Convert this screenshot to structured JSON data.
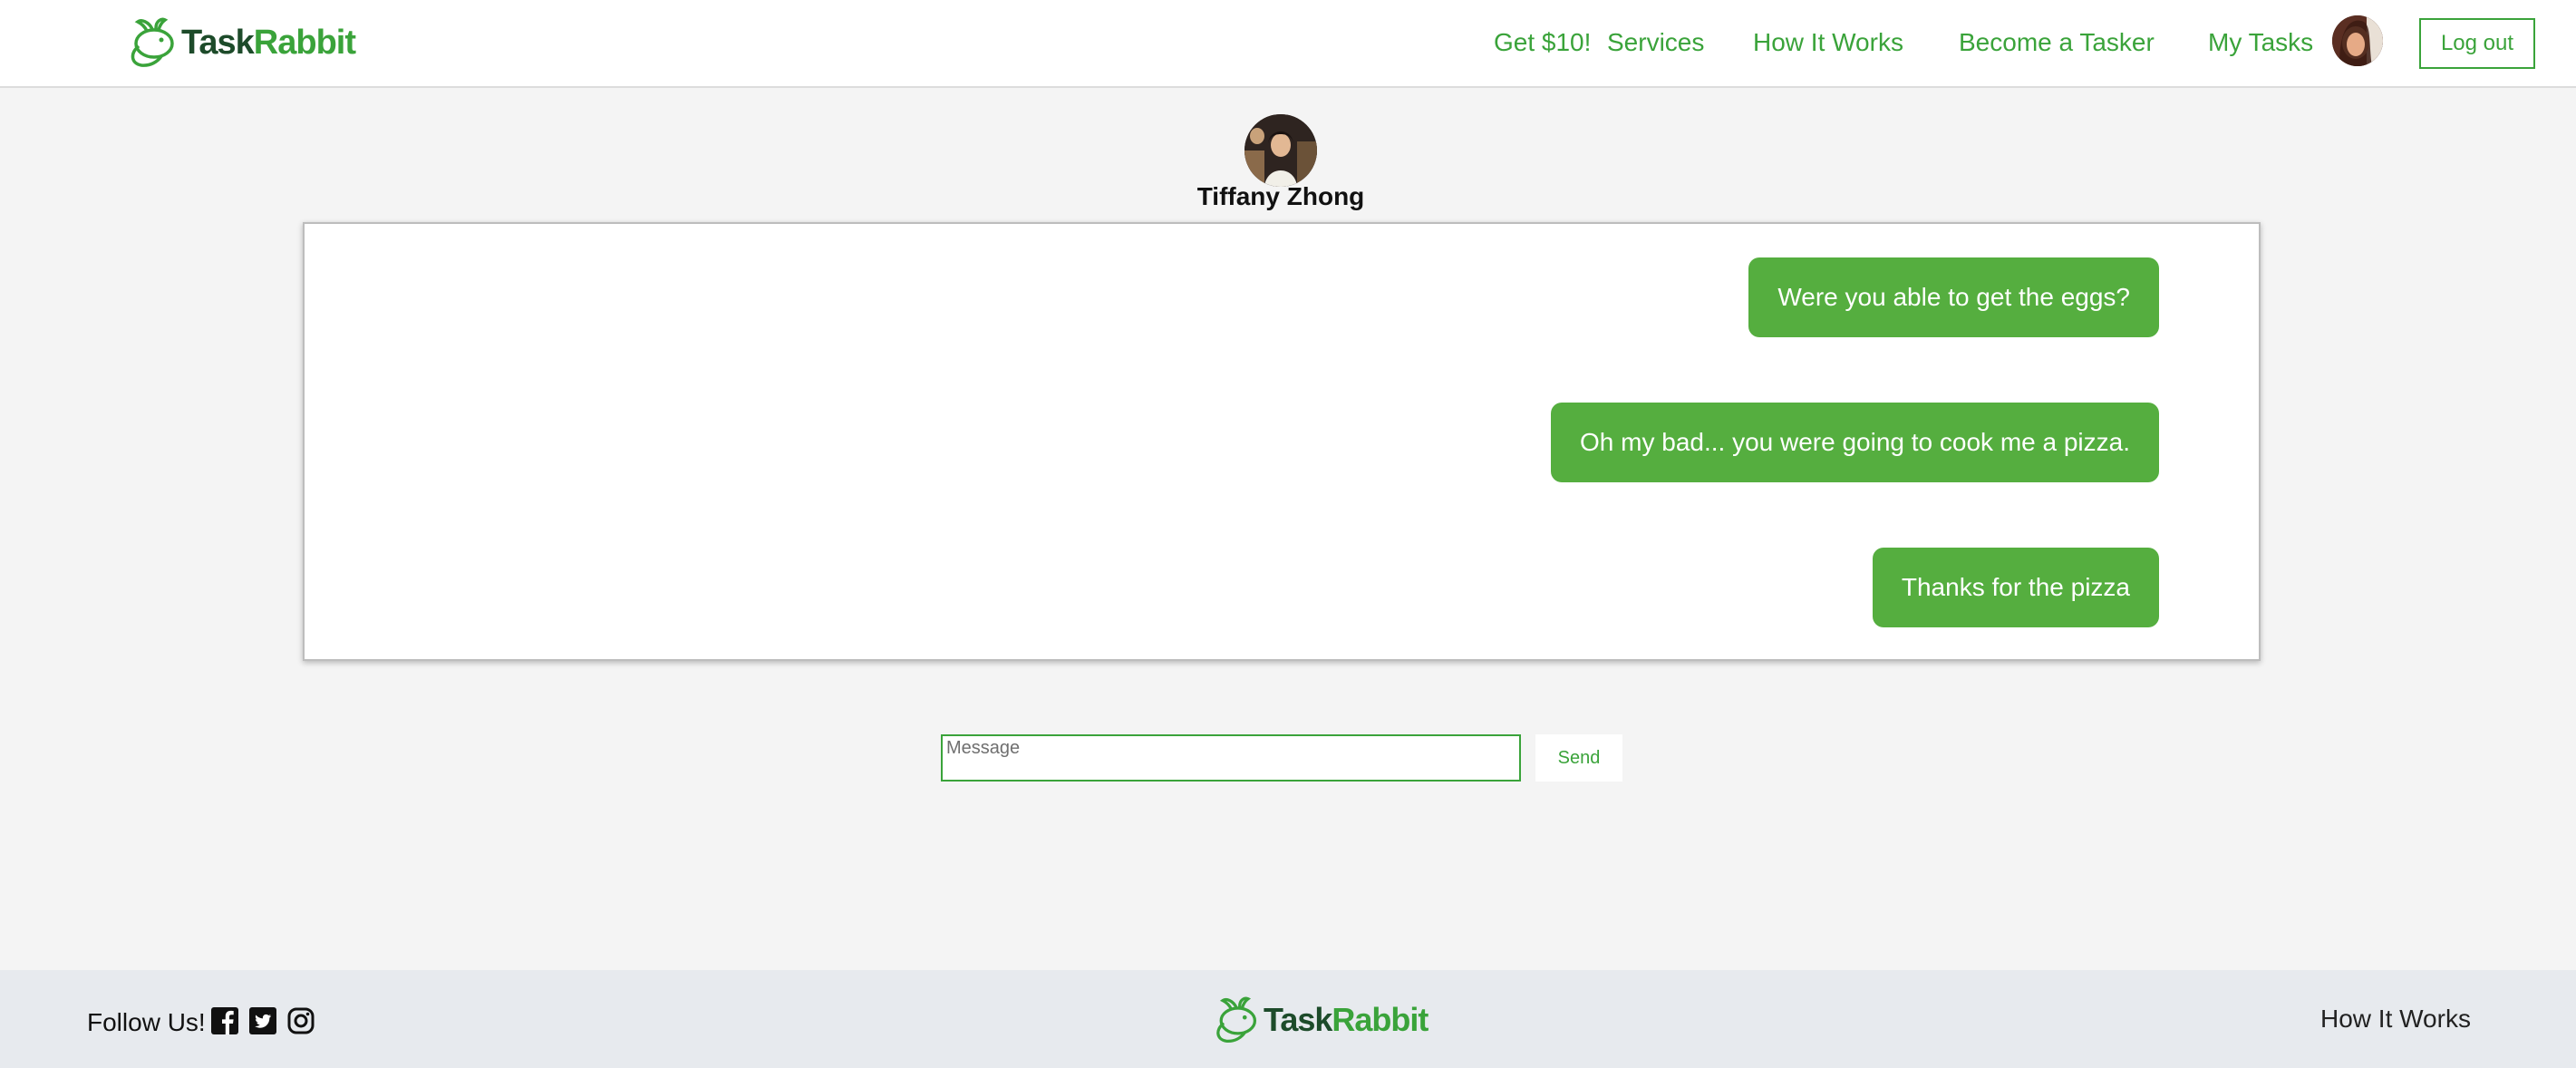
{
  "brand": {
    "task": "Task",
    "rabbit": "Rabbit",
    "green": "#3aa33a",
    "dark_green": "#1d4b2a"
  },
  "nav": {
    "promo": "Get $10!",
    "services": "Services",
    "how_it_works": "How It Works",
    "become_tasker": "Become a Tasker",
    "my_tasks": "My Tasks",
    "logout": "Log out"
  },
  "conversation": {
    "partner_name": "Tiffany Zhong",
    "messages": [
      {
        "text": "Were you able to get the eggs?",
        "sender": "me"
      },
      {
        "text": "Oh my bad... you were going to cook me a pizza.",
        "sender": "me"
      },
      {
        "text": "Thanks for the pizza",
        "sender": "me"
      }
    ],
    "bubble_color": "#55ae3f"
  },
  "composer": {
    "placeholder": "Message",
    "send_label": "Send"
  },
  "footer": {
    "follow_label": "Follow Us!",
    "social_icons": [
      "facebook-icon",
      "twitter-icon",
      "instagram-icon"
    ],
    "how_it_works": "How It Works"
  }
}
